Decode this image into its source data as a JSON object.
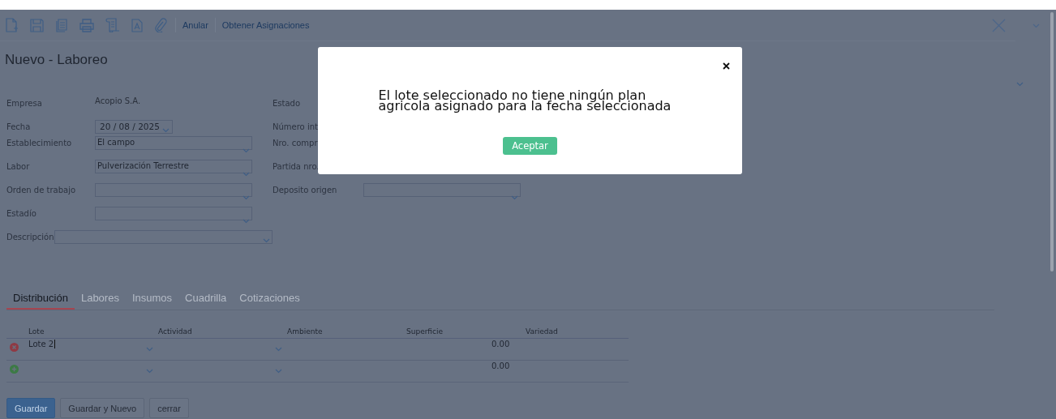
{
  "toolbar": {
    "actions": [
      {
        "label": "Anular"
      },
      {
        "label": "Obtener Asignaciones"
      }
    ]
  },
  "title": "Nuevo - Laboreo",
  "form": {
    "rows": [
      {
        "left": {
          "label": "Empresa",
          "kind": "text",
          "value": "Acopio S.A."
        },
        "right": {
          "label": "Estado",
          "kind": "label"
        }
      },
      {
        "left": {
          "label": "Fecha",
          "kind": "date",
          "value": "20 / 08 / 2025"
        },
        "right": {
          "label": "Número int",
          "kind": "label"
        }
      },
      {
        "left": {
          "label": "Establecimiento",
          "kind": "select",
          "value": "El campo"
        },
        "right": {
          "label": "Nro. compr",
          "kind": "label"
        }
      },
      {
        "left": {
          "label": "Labor",
          "kind": "select",
          "value": "Pulverización Terrestre"
        },
        "right": {
          "label": "Partida nro.",
          "kind": "label"
        }
      },
      {
        "left": {
          "label": "Orden de trabajo",
          "kind": "select"
        },
        "right": {
          "label": "Deposito origen",
          "kind": "select"
        }
      },
      {
        "left": {
          "label": "Estadío",
          "kind": "select"
        }
      },
      {
        "left": {
          "label": "Descripción",
          "kind": "wide"
        }
      }
    ]
  },
  "tabs": [
    {
      "label": "Distribución",
      "selected": true
    },
    {
      "label": "Labores",
      "selected": false
    },
    {
      "label": "Insumos",
      "selected": false
    },
    {
      "label": "Cuadrilla",
      "selected": false
    },
    {
      "label": "Cotizaciones",
      "selected": false
    }
  ],
  "table": {
    "columns": [
      "Lote",
      "Actividad",
      "Ambiente",
      "Superficie",
      "Variedad"
    ],
    "rows": [
      {
        "kind": "remove",
        "lote": "Lote 2",
        "superficie": "0.00"
      },
      {
        "kind": "add",
        "superficie": "0.00"
      }
    ]
  },
  "buttons": [
    {
      "label": "Guardar",
      "kind": "primary"
    },
    {
      "label": "Guardar y Nuevo",
      "kind": "default"
    },
    {
      "label": "cerrar",
      "kind": "default"
    }
  ],
  "dialog": {
    "message_lines": [
      "El lote seleccionado no tiene ningún plan",
      "agricola asignado para la fecha seleccionada"
    ],
    "button": "Aceptar"
  }
}
